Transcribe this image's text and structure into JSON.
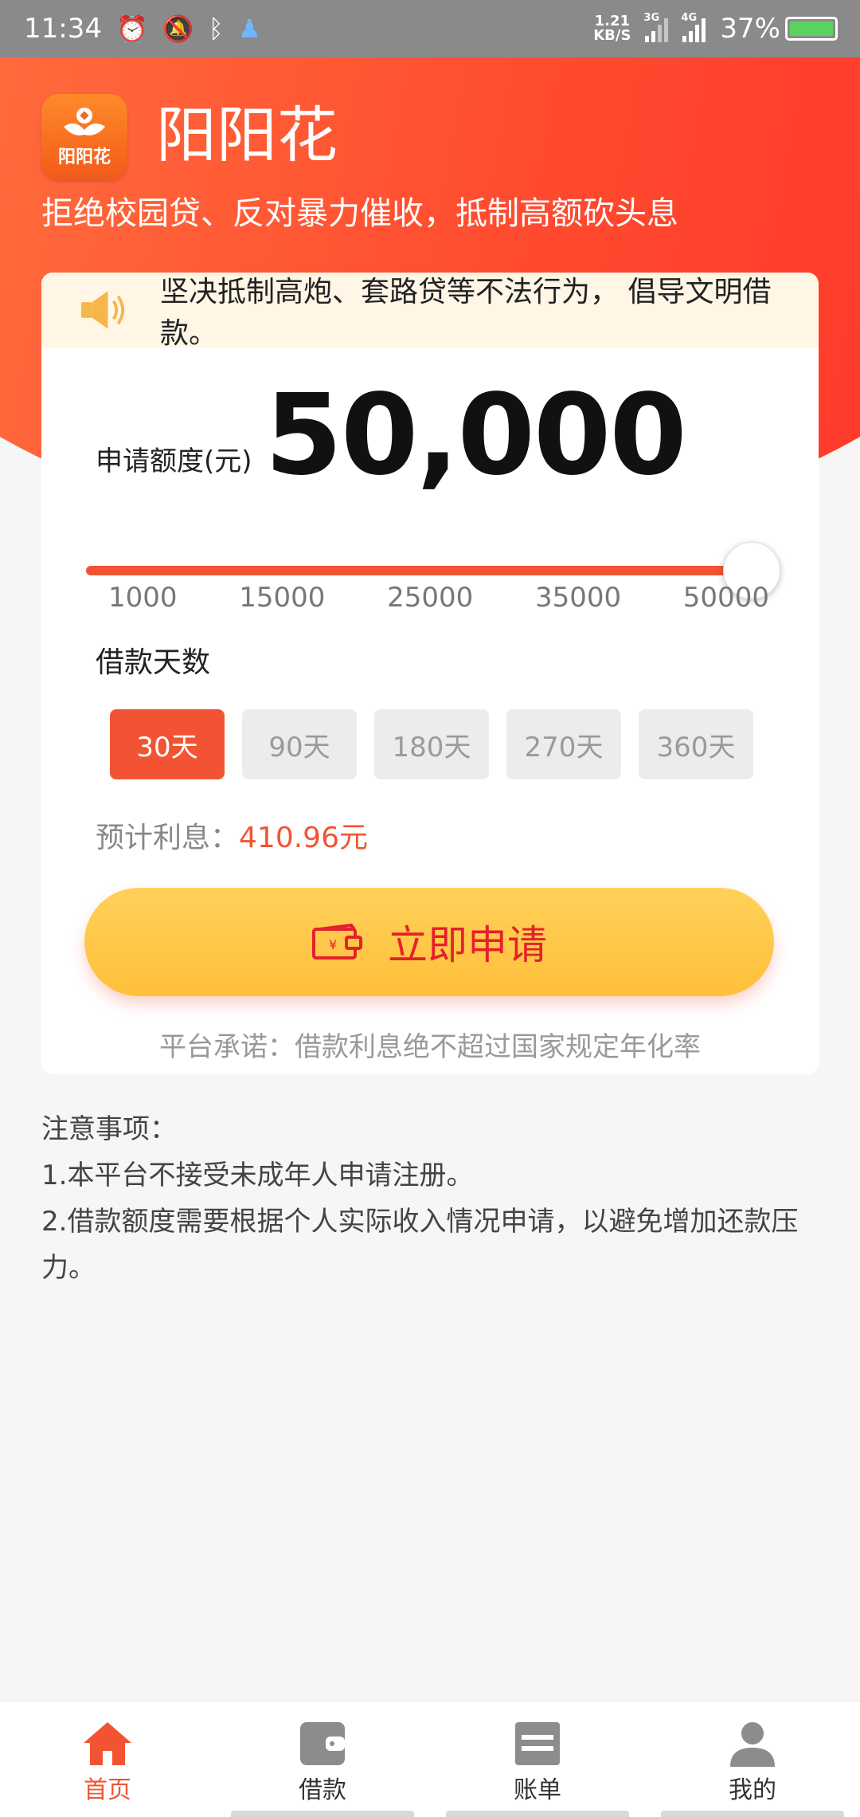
{
  "status_bar": {
    "time": "11:34",
    "speed_value": "1.21",
    "speed_unit": "KB/S",
    "signal1_tag": "3G",
    "signal2_tag": "4G",
    "battery": "37%"
  },
  "header": {
    "logo_text": "阳阳花",
    "title": "阳阳花",
    "slogan": "拒绝校园贷、反对暴力催收，抵制高额砍头息"
  },
  "notice": {
    "text": "坚决抵制高炮、套路贷等不法行为， 倡导文明借款。"
  },
  "loan": {
    "amount_label": "申请额度(元)",
    "amount_value": "50,000",
    "slider_fraction": 1.0,
    "ticks": [
      "1000",
      "15000",
      "25000",
      "35000",
      "50000"
    ],
    "days_label": "借款天数",
    "days": [
      "30天",
      "90天",
      "180天",
      "270天",
      "360天"
    ],
    "selected_day_index": 0,
    "interest_label": "预计利息：",
    "interest_value": "410.96元",
    "apply_label": "立即申请",
    "promise": "平台承诺：借款利息绝不超过国家规定年化率"
  },
  "notes": {
    "title": "注意事项：",
    "items": [
      "1.本平台不接受未成年人申请注册。",
      "2.借款额度需要根据个人实际收入情况申请，以避免增加还款压力。"
    ]
  },
  "tabbar": {
    "items": [
      {
        "label": "首页",
        "icon": "home-icon"
      },
      {
        "label": "借款",
        "icon": "wallet-icon"
      },
      {
        "label": "账单",
        "icon": "bill-icon"
      },
      {
        "label": "我的",
        "icon": "profile-icon"
      }
    ],
    "active_index": 0
  },
  "colors": {
    "accent": "#f25433",
    "button_yellow": "#ffc844",
    "button_text": "#e3212c"
  }
}
